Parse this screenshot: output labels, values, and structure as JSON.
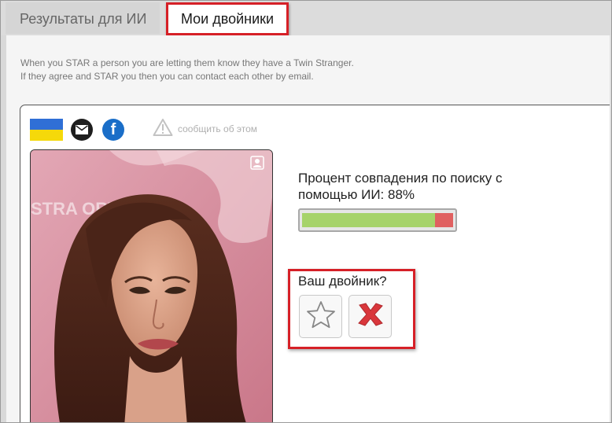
{
  "tabs": {
    "ai_results_label": "Результаты для ИИ",
    "my_twins_label": "Мои двойники"
  },
  "info": {
    "line1": "When you STAR a person you are letting them know they have a Twin Stranger.",
    "line2": "If they agree and STAR you then you can contact each other by email."
  },
  "card": {
    "report_label": "сообщить об этом",
    "match_text": "Процент совпадения по поиску с помощью ИИ: 88%",
    "match_percent": 88,
    "twin_question": "Ваш двойник?",
    "photo_bg_text": "STRA ORTE"
  },
  "colors": {
    "accent_red": "#d62027",
    "bar_green": "#a6d36a",
    "bar_red": "#e06060",
    "flag_blue": "#2f6fd6",
    "flag_yellow": "#f5d90a",
    "facebook_blue": "#1a6ec8"
  },
  "icons": [
    "flag-ukraine-icon",
    "mail-icon",
    "facebook-icon",
    "warning-icon",
    "user-icon",
    "star-icon",
    "x-icon"
  ]
}
